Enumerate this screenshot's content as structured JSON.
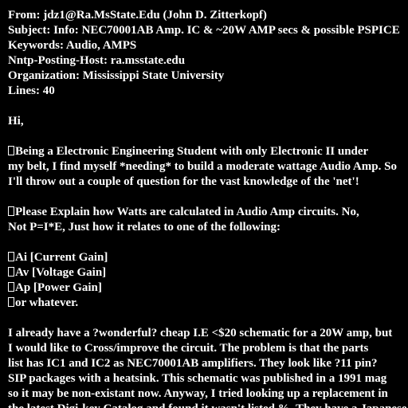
{
  "header": {
    "from": "From: jdz1@Ra.MsState.Edu (John D. Zitterkopf)",
    "subject": "Subject: Info: NEC70001AB Amp. IC & ~20W AMP secs & possible PSPICE",
    "keywords": "Keywords: Audio, AMPS",
    "nntp_host": "Nntp-Posting-Host: ra.msstate.edu",
    "organization": "Organization: Mississippi State University",
    "lines": "Lines: 40"
  },
  "body": {
    "greeting": "Hi,",
    "para1_line1": "Being a Electronic Engineering Student with only Electronic II under",
    "para1_line2": "my belt, I find myself *needing* to build a moderate wattage Audio Amp. So",
    "para1_line3": "I'll throw out a couple of question for the vast knowledge of the 'net'!",
    "para2_line1": "Please Explain how Watts are calculated in Audio Amp circuits. No,",
    "para2_line2": "Not P=I*E, Just how it relates to one of the following:",
    "list_items": [
      "Ai [Current Gain]",
      "Av [Voltage Gain]",
      "Ap [Power Gain]",
      "or whatever."
    ],
    "para3_line1": "I already have a ?wonderful? cheap I.E <$20 schematic for a 20W amp, but",
    "para3_line2": "I would like to Cross/improve the circuit. The problem is that the parts",
    "para3_line3": "list has IC1 and IC2 as NEC70001AB amplifiers. They look like ?11 pin?",
    "para3_line4": "SIP packages with a heatsink. This schematic was published in a 1991 mag",
    "para3_line5": "so it may be non-existant now. Anyway, I tried looking up a replacement in",
    "para3_line6": "the latest Digi-key Catalog and found it wasn't listed %. They have a Japanese"
  }
}
